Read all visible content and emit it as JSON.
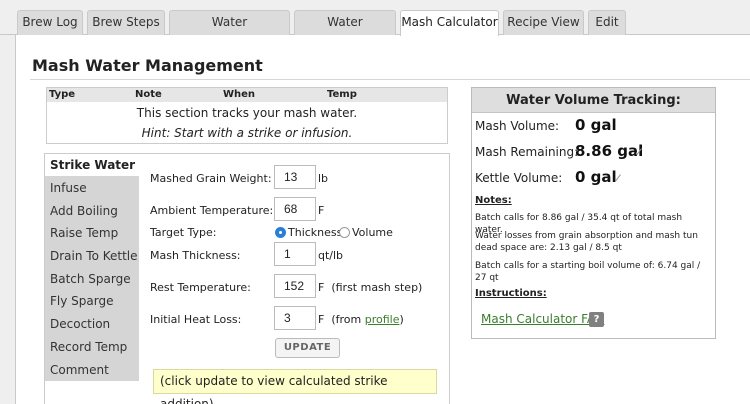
{
  "tabs": [
    {
      "label": "Brew Log"
    },
    {
      "label": "Brew Steps"
    },
    {
      "label": "Water Requirements"
    },
    {
      "label": "Water Chemistry"
    },
    {
      "label": "Mash Calculator",
      "active": true
    },
    {
      "label": "Recipe View"
    },
    {
      "label": "Edit"
    }
  ],
  "page_title": "Mash Water Management",
  "mash_log": {
    "columns": [
      "Type",
      "Note",
      "When",
      "Temp"
    ],
    "message": "This section tracks your mash water.",
    "hint": "Hint: Start with a strike or infusion."
  },
  "side_nav": [
    {
      "label": "Strike Water",
      "active": true
    },
    {
      "label": "Infuse"
    },
    {
      "label": "Add Boiling"
    },
    {
      "label": "Raise Temp"
    },
    {
      "label": "Drain To Kettle"
    },
    {
      "label": "Batch Sparge"
    },
    {
      "label": "Fly Sparge"
    },
    {
      "label": "Decoction"
    },
    {
      "label": "Record Temp"
    },
    {
      "label": "Comment"
    }
  ],
  "form": {
    "grain_weight": {
      "label": "Mashed Grain Weight:",
      "value": "13",
      "unit": "lb"
    },
    "ambient_temp": {
      "label": "Ambient Temperature:",
      "value": "68",
      "unit": "F"
    },
    "target_type": {
      "label": "Target Type:",
      "option1": "Thickness",
      "option2": "Volume",
      "selected": "Thickness"
    },
    "mash_thickness": {
      "label": "Mash Thickness:",
      "value": "1",
      "unit": "qt/lb"
    },
    "rest_temp": {
      "label": "Rest Temperature:",
      "value": "152",
      "unit": "F  (first mash step)"
    },
    "heat_loss": {
      "label": "Initial Heat Loss:",
      "value": "3",
      "unit_prefix": "F  (from ",
      "link": "profile",
      "unit_suffix": ")"
    },
    "update_button": "UPDATE",
    "result_message": "(click update to view calculated strike addition)"
  },
  "water_volume": {
    "title": "Water Volume Tracking:",
    "mash_volume": {
      "label": "Mash Volume:",
      "value": "0 gal"
    },
    "mash_remaining": {
      "label": "Mash Remaining:",
      "value": "8.86 gal",
      "check": "✓"
    },
    "kettle_volume": {
      "label": "Kettle Volume:",
      "value": "0 gal",
      "check": "✓"
    },
    "notes_title": "Notes:",
    "notes": [
      "Batch calls for 8.86 gal / 35.4 qt of total mash water.",
      "Water losses from grain absorption and mash tun dead space are: 2.13 gal / 8.5 qt",
      "Batch calls for a starting boil volume of: 6.74 gal / 27 qt"
    ],
    "instructions_title": "Instructions:",
    "faq_link": "Mash Calculator FAQ",
    "help_icon": "?"
  }
}
